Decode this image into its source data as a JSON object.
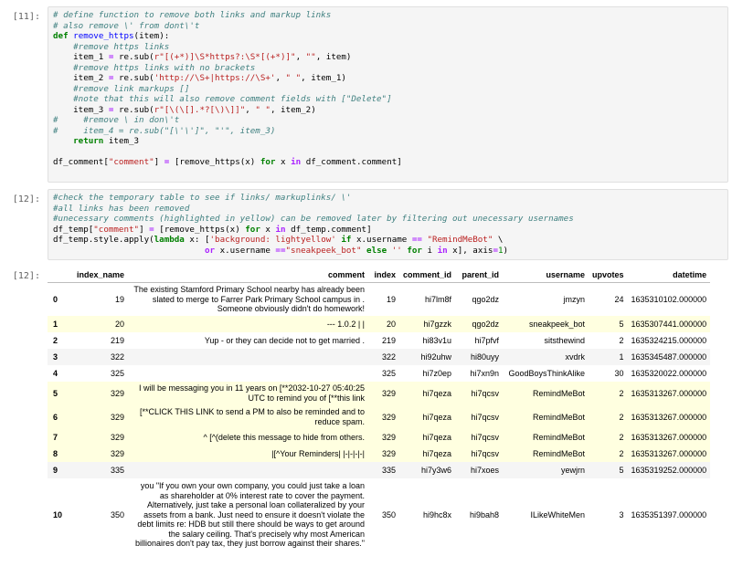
{
  "cells": [
    {
      "prompt": "[11]:"
    },
    {
      "prompt": "[12]:"
    },
    {
      "prompt": "[12]:"
    }
  ],
  "code11": [
    "# define function to remove both links and markup links",
    "# also remove \\' from dont\\'t",
    "def remove_https(item):",
    "    #remove https links",
    "    item_1 = re.sub(r\"[(+*)]\\S*https?:\\S*[(+*)]\", \"\", item)",
    "    #remove https links with no brackets",
    "    item_2 = re.sub('http://\\S+|https://\\S+', \" \", item_1)",
    "    #remove link markups []",
    "    #note that this will also remove comment fields with [\"Delete\"]",
    "    item_3 = re.sub(r\"[\\(\\[].*?[\\)\\]]\", \" \", item_2)",
    "#     #remove \\ in don\\'t",
    "#     item_4 = re.sub(\"[\\'\\']\", \"'\", item_3)",
    "    return item_3",
    "",
    "df_comment[\"comment\"] = [remove_https(x) for x in df_comment.comment]"
  ],
  "code12": [
    "#check the temporary table to see if links/ markuplinks/ \\'",
    "#all links has been removed",
    "#unecessary comments (highlighted in yellow) can be removed later by filtering out unecessary usernames",
    "df_temp[\"comment\"] = [remove_https(x) for x in df_temp.comment]",
    "df_temp.style.apply(lambda x: ['background: lightyellow' if x.username == \"RemindMeBot\" \\",
    "                              or x.username ==\"sneakpeek_bot\" else '' for i in x], axis=1)"
  ],
  "table": {
    "headers": [
      "",
      "index_name",
      "comment",
      "index",
      "comment_id",
      "parent_id",
      "username",
      "upvotes",
      "datetime"
    ],
    "rows": [
      {
        "idx": "0",
        "index_name": "19",
        "comment": "The existing Stamford Primary School nearby has already been slated to merge to Farrer Park Primary School campus in . Someone obviously didn't do homework!",
        "index": "19",
        "comment_id": "hi7lm8f",
        "parent_id": "qgo2dz",
        "username": "jmzyn",
        "upvotes": "24",
        "datetime": "1635310102.000000",
        "hl": false
      },
      {
        "idx": "1",
        "index_name": "20",
        "comment": "--- 1.0.2 | |",
        "index": "20",
        "comment_id": "hi7gzzk",
        "parent_id": "qgo2dz",
        "username": "sneakpeek_bot",
        "upvotes": "5",
        "datetime": "1635307441.000000",
        "hl": true
      },
      {
        "idx": "2",
        "index_name": "219",
        "comment": "Yup - or they can decide not to get married .",
        "index": "219",
        "comment_id": "hi83v1u",
        "parent_id": "hi7pfvf",
        "username": "sitsthewind",
        "upvotes": "2",
        "datetime": "1635324215.000000",
        "hl": false
      },
      {
        "idx": "3",
        "index_name": "322",
        "comment": "",
        "index": "322",
        "comment_id": "hi92uhw",
        "parent_id": "hi80uyy",
        "username": "xvdrk",
        "upvotes": "1",
        "datetime": "1635345487.000000",
        "hl": false
      },
      {
        "idx": "4",
        "index_name": "325",
        "comment": "",
        "index": "325",
        "comment_id": "hi7z0ep",
        "parent_id": "hi7xn9n",
        "username": "GoodBoysThinkAlike",
        "upvotes": "30",
        "datetime": "1635320022.000000",
        "hl": false
      },
      {
        "idx": "5",
        "index_name": "329",
        "comment": "I will be messaging you in 11 years on [**2032-10-27 05:40:25 UTC to remind you of [**this link",
        "index": "329",
        "comment_id": "hi7qeza",
        "parent_id": "hi7qcsv",
        "username": "RemindMeBot",
        "upvotes": "2",
        "datetime": "1635313267.000000",
        "hl": true
      },
      {
        "idx": "6",
        "index_name": "329",
        "comment": "[**CLICK THIS LINK to send a PM to also be reminded and to reduce spam.",
        "index": "329",
        "comment_id": "hi7qeza",
        "parent_id": "hi7qcsv",
        "username": "RemindMeBot",
        "upvotes": "2",
        "datetime": "1635313267.000000",
        "hl": true
      },
      {
        "idx": "7",
        "index_name": "329",
        "comment": "^ [^(delete this message to hide from others.",
        "index": "329",
        "comment_id": "hi7qeza",
        "parent_id": "hi7qcsv",
        "username": "RemindMeBot",
        "upvotes": "2",
        "datetime": "1635313267.000000",
        "hl": true
      },
      {
        "idx": "8",
        "index_name": "329",
        "comment": "|[^Your Reminders| |-|-|-|-|",
        "index": "329",
        "comment_id": "hi7qeza",
        "parent_id": "hi7qcsv",
        "username": "RemindMeBot",
        "upvotes": "2",
        "datetime": "1635313267.000000",
        "hl": true
      },
      {
        "idx": "9",
        "index_name": "335",
        "comment": "",
        "index": "335",
        "comment_id": "hi7y3w6",
        "parent_id": "hi7xoes",
        "username": "yewjrn",
        "upvotes": "5",
        "datetime": "1635319252.000000",
        "hl": false
      },
      {
        "idx": "10",
        "index_name": "350",
        "comment": "you \"If you own your own company, you could just take a loan as shareholder at 0% interest rate to cover the payment. Alternatively, just take a personal loan collateralized by your assets from a bank. Just need to ensure it doesn't violate the debt limits re: HDB but still there should be ways to get around the salary ceiling. That's precisely why most American billionaires don't pay tax, they just borrow against their shares.\"",
        "index": "350",
        "comment_id": "hi9hc8x",
        "parent_id": "hi9bah8",
        "username": "ILikeWhiteMen",
        "upvotes": "3",
        "datetime": "1635351397.000000",
        "hl": false
      }
    ]
  }
}
